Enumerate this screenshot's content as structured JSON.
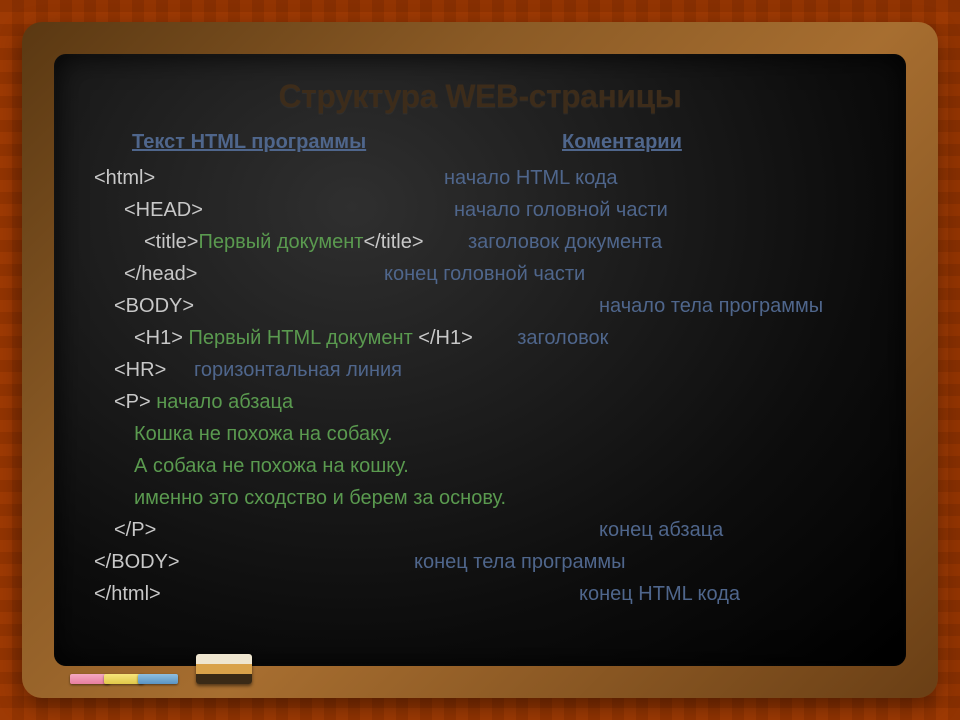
{
  "title": "Структура WEB-страницы",
  "headers": {
    "left": "Текст HTML программы",
    "right": "Коментарии"
  },
  "lines": [
    {
      "indent": 0,
      "tag": "<html>",
      "content": "",
      "comment": "начало HTML кода",
      "comment_col": 350,
      "tag_w": 350
    },
    {
      "indent": 30,
      "tag": "<HEAD>",
      "content": "",
      "comment": "начало головной части",
      "comment_col": 330,
      "tag_w": 330
    },
    {
      "indent": 50,
      "tag": "<title>",
      "content": "Первый документ",
      "tag2": "</title>",
      "comment": "заголовок документа",
      "comment_col": 485,
      "tag_w": 58
    },
    {
      "indent": 30,
      "tag": "</head>",
      "content": "",
      "comment": "конец головной части",
      "comment_col": 260,
      "tag_w": 260
    },
    {
      "indent": 20,
      "tag": "<BODY>",
      "content": "",
      "comment": "начало тела программы",
      "comment_col": 485,
      "tag_w": 485
    },
    {
      "indent": 40,
      "tag": "<H1>",
      "content": " Первый HTML документ ",
      "tag2": "</H1>",
      "comment": "заголовок",
      "comment_col": 400,
      "tag_w": 58
    },
    {
      "indent": 20,
      "tag": "<HR>",
      "content": "горизонтальная линия",
      "comment": "",
      "comment_col": 0,
      "tag_w": 120,
      "special": "green-comment-style"
    },
    {
      "indent": 20,
      "tag": "<P> ",
      "content": "начало абзаца",
      "comment": "",
      "comment_col": 0,
      "tag_w": 60
    },
    {
      "indent": 40,
      "tag": "",
      "content": "Кошка не похожа на собаку.",
      "comment": "",
      "comment_col": 0,
      "tag_w": 0
    },
    {
      "indent": 40,
      "tag": "",
      "content": "А собака не похожа на кошку.",
      "comment": "",
      "comment_col": 0,
      "tag_w": 0
    },
    {
      "indent": 40,
      "tag": "",
      "content": "именно это сходство и берем за основу.",
      "comment": "",
      "comment_col": 0,
      "tag_w": 0
    },
    {
      "indent": 20,
      "tag": "</P>",
      "content": "",
      "comment": "конец абзаца",
      "comment_col": 485,
      "tag_w": 485
    },
    {
      "indent": 0,
      "tag": "</BODY>",
      "content": "",
      "comment": "конец тела программы",
      "comment_col": 320,
      "tag_w": 320
    },
    {
      "indent": 0,
      "tag": "</html>",
      "content": "",
      "comment": "конец HTML кода",
      "comment_col": 485,
      "tag_w": 485
    }
  ]
}
